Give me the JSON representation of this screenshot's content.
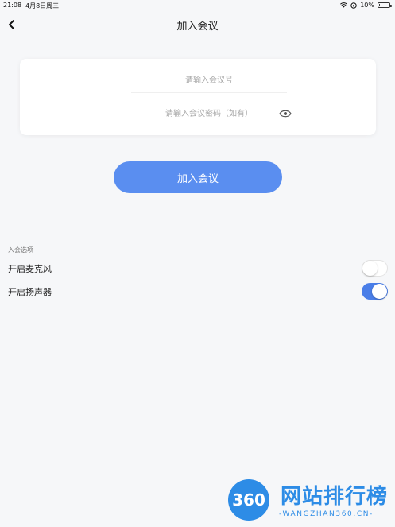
{
  "status_bar": {
    "time": "21:08",
    "date": "4月8日周三",
    "battery": "10%",
    "battery_level": 0.1
  },
  "nav": {
    "title": "加入会议",
    "back_icon": "chevron-left-icon"
  },
  "form": {
    "meeting_id_placeholder": "请输入会议号",
    "password_placeholder": "请输入会议密码（如有）",
    "eye_icon": "eye-icon"
  },
  "join_button": {
    "label": "加入会议",
    "color": "#5a8ef0"
  },
  "options": {
    "section_label": "入会选项",
    "items": [
      {
        "label": "开启麦克风",
        "enabled": false
      },
      {
        "label": "开启扬声器",
        "enabled": true
      }
    ],
    "toggle_on_color": "#4a7ee8"
  },
  "watermark": {
    "logo_text": "360",
    "title": "网站排行榜",
    "subtitle": "-WANGZHAN360.CN-"
  }
}
